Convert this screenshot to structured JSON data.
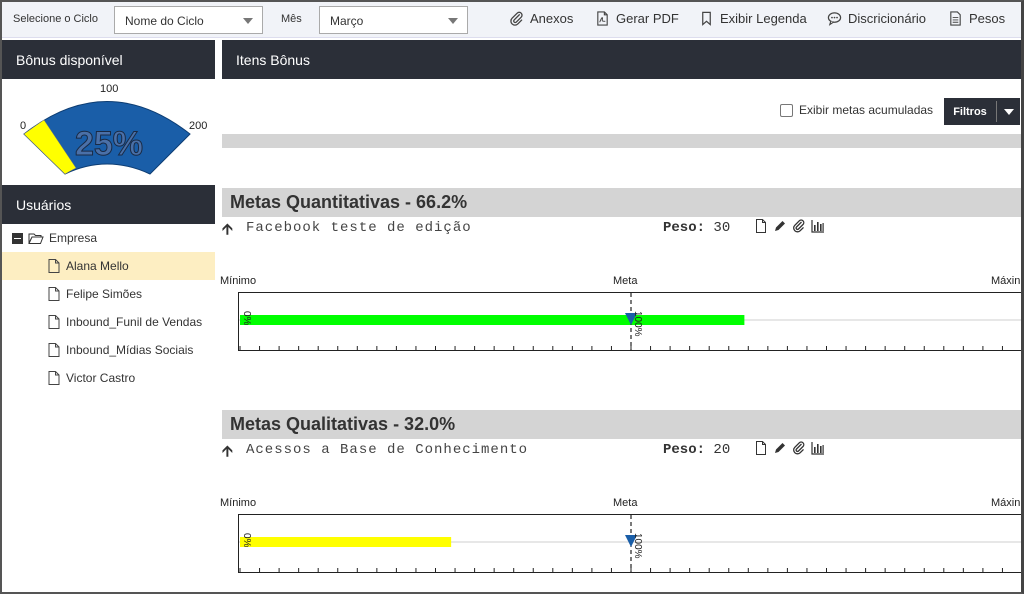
{
  "toolbar": {
    "cycle_label": "Selecione o Ciclo",
    "cycle_value": "Nome do Ciclo",
    "month_label": "Mês",
    "month_value": "Março",
    "actions": {
      "anexos": "Anexos",
      "gerar_pdf": "Gerar PDF",
      "exibir_legenda": "Exibir Legenda",
      "discricionario": "Discricionário",
      "pesos": "Pesos"
    }
  },
  "bonus": {
    "title": "Bônus disponível",
    "gauge": {
      "min_label": "0",
      "mid_label": "100",
      "max_label": "200",
      "percent_text": "25%",
      "level": 25,
      "arc_color": "#1a5ea8",
      "needle_color": "#ffff00"
    }
  },
  "users": {
    "title": "Usuários",
    "root": "Empresa",
    "items": [
      {
        "label": "Alana Mello",
        "selected": true
      },
      {
        "label": "Felipe Simões",
        "selected": false
      },
      {
        "label": "Inbound_Funil de Vendas",
        "selected": false
      },
      {
        "label": "Inbound_Mídias Sociais",
        "selected": false
      },
      {
        "label": "Victor Castro",
        "selected": false
      }
    ]
  },
  "main": {
    "title": "Itens Bônus",
    "accumulated_label": "Exibir metas acumuladas",
    "filter_label": "Filtros",
    "sections": [
      {
        "title": "Metas Quantitativas - 66.2%",
        "item_name": "Facebook teste de edição",
        "peso_label": "Peso:",
        "peso_value": "30",
        "chart": {
          "min_label": "Mínimo",
          "meta_label": "Meta",
          "max_label": "Máxin",
          "zero_label": "0%",
          "meta_value_label": "100%",
          "bar_value": 129,
          "bar_color": "#00ff00",
          "scale_max": 200
        }
      },
      {
        "title": "Metas Qualitativas - 32.0%",
        "item_name": "Acessos a Base de Conhecimento",
        "peso_label": "Peso:",
        "peso_value": "20",
        "chart": {
          "min_label": "Mínimo",
          "meta_label": "Meta",
          "max_label": "Máxin",
          "zero_label": "0%",
          "meta_value_label": "100%",
          "bar_value": 54,
          "bar_color": "#ffff00",
          "scale_max": 200
        }
      }
    ]
  }
}
